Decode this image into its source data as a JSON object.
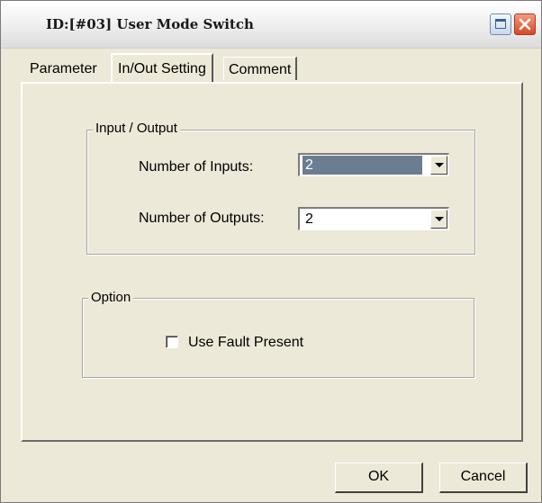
{
  "window": {
    "title": "ID:[#03]  User Mode Switch"
  },
  "tabs": [
    {
      "label": "Parameter",
      "selected": false
    },
    {
      "label": "In/Out Setting",
      "selected": true
    },
    {
      "label": "Comment",
      "selected": false
    }
  ],
  "input_output_group": {
    "legend": "Input / Output",
    "inputs_label": "Number of Inputs:",
    "inputs_value": "2",
    "outputs_label": "Number of Outputs:",
    "outputs_value": "2"
  },
  "option_group": {
    "legend": "Option",
    "use_fault_present_label": "Use Fault Present",
    "use_fault_present_checked": false
  },
  "buttons": {
    "ok": "OK",
    "cancel": "Cancel"
  },
  "icons": [
    "maximize-icon",
    "close-icon",
    "chevron-down-icon"
  ]
}
